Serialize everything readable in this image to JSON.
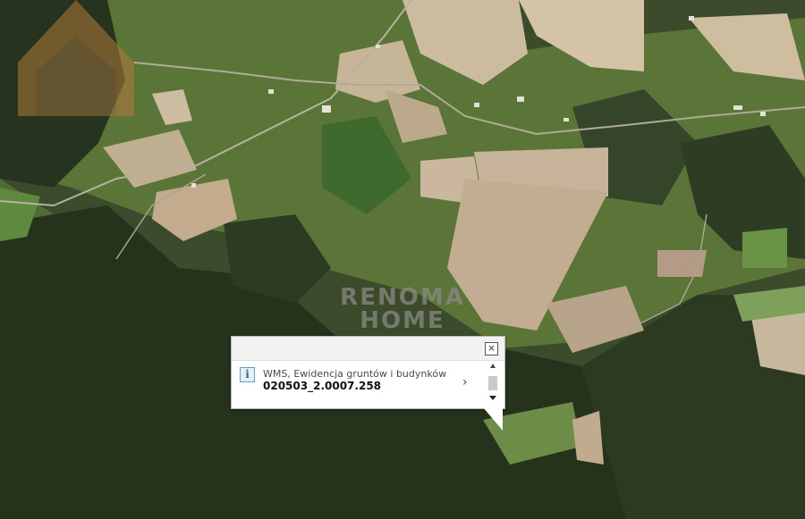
{
  "map": {
    "watermark_text_line1": "RENOMA",
    "watermark_text_line2": "HOME"
  },
  "popup": {
    "info_icon": "i",
    "layer_name": "WMS, Ewidencja gruntów i budynków",
    "parcel_id": "020503_2.0007.258",
    "close_icon": "close-icon",
    "next_icon": "chevron-right-icon"
  },
  "colors": {
    "forest_dark": "#26331e",
    "field_light": "#c9b79a",
    "meadow": "#5f7a3a",
    "popup_bg": "#ffffff"
  }
}
